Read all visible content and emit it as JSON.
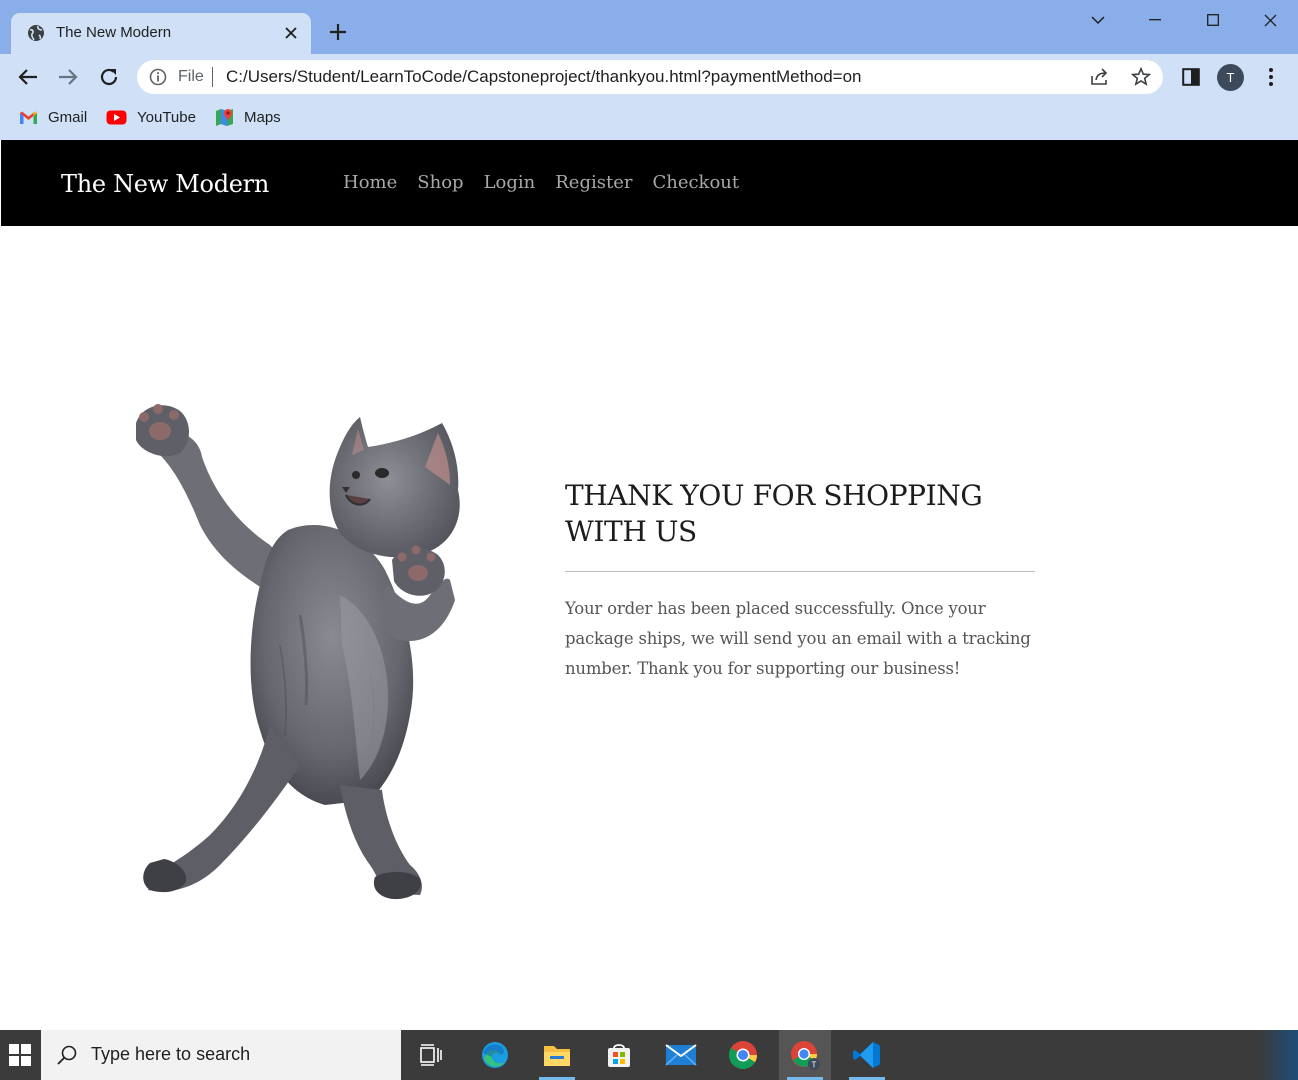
{
  "browser": {
    "tab_title": "The New Modern",
    "file_label": "File",
    "url": "C:/Users/Student/LearnToCode/Capstoneproject/thankyou.html?paymentMethod=on",
    "profile_initial": "T",
    "bookmarks": [
      {
        "label": "Gmail",
        "icon": "gmail-icon"
      },
      {
        "label": "YouTube",
        "icon": "youtube-icon"
      },
      {
        "label": "Maps",
        "icon": "maps-icon"
      }
    ]
  },
  "site": {
    "brand": "The New Modern",
    "nav": [
      "Home",
      "Shop",
      "Login",
      "Register",
      "Checkout"
    ]
  },
  "confirmation": {
    "heading_line1": "THANK YOU FOR SHOPPING",
    "heading_line2": "WITH US",
    "message": "Your order has been placed successfully. Once your package ships, we will send you an email with a tracking number. Thank you for supporting our business!",
    "image": "dancing-cat-image"
  },
  "taskbar": {
    "search_placeholder": "Type here to search",
    "apps": [
      "task-view",
      "edge",
      "file-explorer",
      "microsoft-store",
      "mail",
      "chrome",
      "chrome-profile",
      "vs-code"
    ]
  },
  "colors": {
    "header_bg": "#000000",
    "nav_text": "#a8a8a8",
    "chrome_frame": "#8aaee9",
    "chrome_toolbar": "#cfe0f7"
  }
}
